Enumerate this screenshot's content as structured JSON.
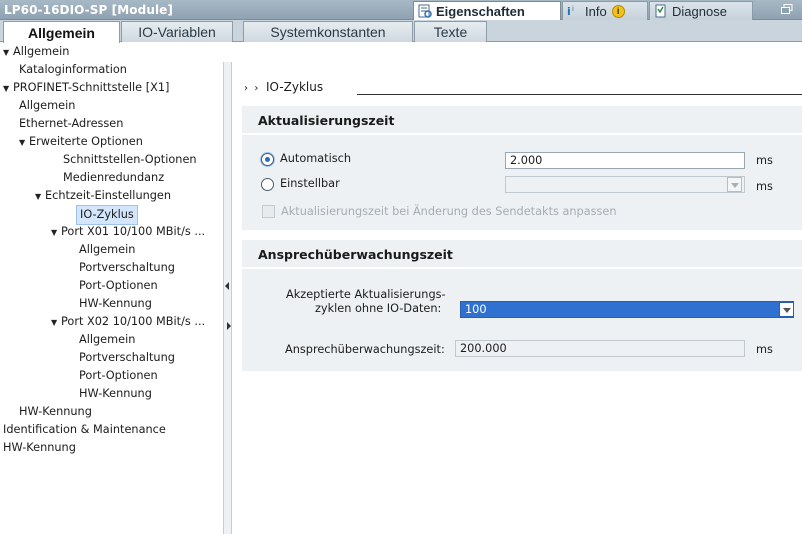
{
  "window": {
    "title": "LP60-16DIO-SP [Module]",
    "tabs": [
      {
        "label": "Eigenschaften"
      },
      {
        "label": "Info"
      },
      {
        "label": "Diagnose"
      }
    ]
  },
  "editor_tabs": [
    {
      "label": "Allgemein"
    },
    {
      "label": "IO-Variablen"
    },
    {
      "label": "Systemkonstanten"
    },
    {
      "label": "Texte"
    }
  ],
  "tree": [
    {
      "label": "Allgemein"
    },
    {
      "label": "Kataloginformation"
    },
    {
      "label": "PROFINET-Schnittstelle [X1]"
    },
    {
      "label": "Allgemein"
    },
    {
      "label": "Ethernet-Adressen"
    },
    {
      "label": "Erweiterte Optionen"
    },
    {
      "label": "Schnittstellen-Optionen"
    },
    {
      "label": "Medienredundanz"
    },
    {
      "label": "Echtzeit-Einstellungen"
    },
    {
      "label": "IO-Zyklus"
    },
    {
      "label": "Port X01 10/100 MBit/s ..."
    },
    {
      "label": "Allgemein"
    },
    {
      "label": "Portverschaltung"
    },
    {
      "label": "Port-Optionen"
    },
    {
      "label": "HW-Kennung"
    },
    {
      "label": "Port X02 10/100 MBit/s ..."
    },
    {
      "label": "Allgemein"
    },
    {
      "label": "Portverschaltung"
    },
    {
      "label": "Port-Optionen"
    },
    {
      "label": "HW-Kennung"
    },
    {
      "label": "HW-Kennung"
    },
    {
      "label": "Identification & Maintenance"
    },
    {
      "label": "HW-Kennung"
    }
  ],
  "breadcrumb": {
    "label": "IO-Zyklus"
  },
  "update_time": {
    "title": "Aktualisierungszeit",
    "radio_auto": "Automatisch",
    "auto_value": "2.000",
    "radio_custom": "Einstellbar",
    "custom_value": "",
    "unit": "ms",
    "checkbox_label": "Aktualisierungszeit bei Änderung des Sendetakts anpassen"
  },
  "watchdog": {
    "title": "Ansprechüberwachungszeit",
    "cycles_label_line1": "Akzeptierte Aktualisierungs-",
    "cycles_label_line2": "zyklen ohne IO-Daten:",
    "cycles_value": "100",
    "time_label": "Ansprechüberwachungszeit:",
    "time_value": "200.000",
    "unit": "ms"
  },
  "colors": {
    "accent": "#3070d0",
    "selection": "#d4e6fb",
    "panel": "#eef1f3"
  }
}
